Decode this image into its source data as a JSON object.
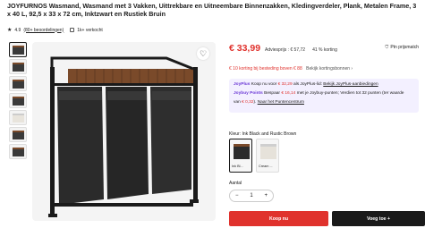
{
  "product": {
    "title": "JOYFURNOS Wasmand, Wasmand met 3 Vakken, Uittrekbare en Uitneembare Binnenzakken, Kledingverdeler, Plank, Metalen Frame, 3 x 40 L, 92,5 x 33 x 72 cm, Inktzwart en Rustiek Bruin",
    "rating": "4.9",
    "reviews_link": "(80+ beoordelingen)",
    "sold": "1k+ verkocht"
  },
  "price": {
    "current": "€ 33,99",
    "rrp_label": "Adviesprijs : € 57,72",
    "discount": "41 % korting",
    "points_tag": "Ptn prijsmatch",
    "accent": "#e0322d"
  },
  "promo": {
    "text": "€ 10 korting bij besteding boven € 88",
    "link": "Bekijk kortingsbonnen ›"
  },
  "joy": {
    "plus_name": "JoyPlus",
    "plus_text_a": " Koop nu voor ",
    "plus_price": "€ 32,29",
    "plus_text_b": " als JoyPlus-lid: ",
    "plus_link": "Bekijk JoyPlus-aanbiedingen",
    "points_name": "Joybuy Points",
    "points_text_a": " Bespaar ",
    "points_amount": "€ 16,14",
    "points_text_b": " met je Joybuy-punten; Verdien tot 32 punten (ter waarde",
    "points_text_c": "van ",
    "points_value": "€ 0,32",
    "points_text_d": "). ",
    "points_link": "Naar het Puntencentrum",
    "accent": "#6c3ad6"
  },
  "color": {
    "label": "Kleur: Ink Black and Rustic Brown",
    "options": [
      {
        "label": "Ink Bl...",
        "selected": true
      },
      {
        "label": "Cream ...",
        "selected": false
      }
    ]
  },
  "quantity": {
    "label": "Aantal",
    "value": "1",
    "minus": "−",
    "plus": "+"
  },
  "actions": {
    "buy": "Koop nu",
    "cart": "Voeg toe +"
  },
  "icons": {
    "heart": "heart-icon",
    "star": "star-icon",
    "shield": "shield-icon"
  }
}
